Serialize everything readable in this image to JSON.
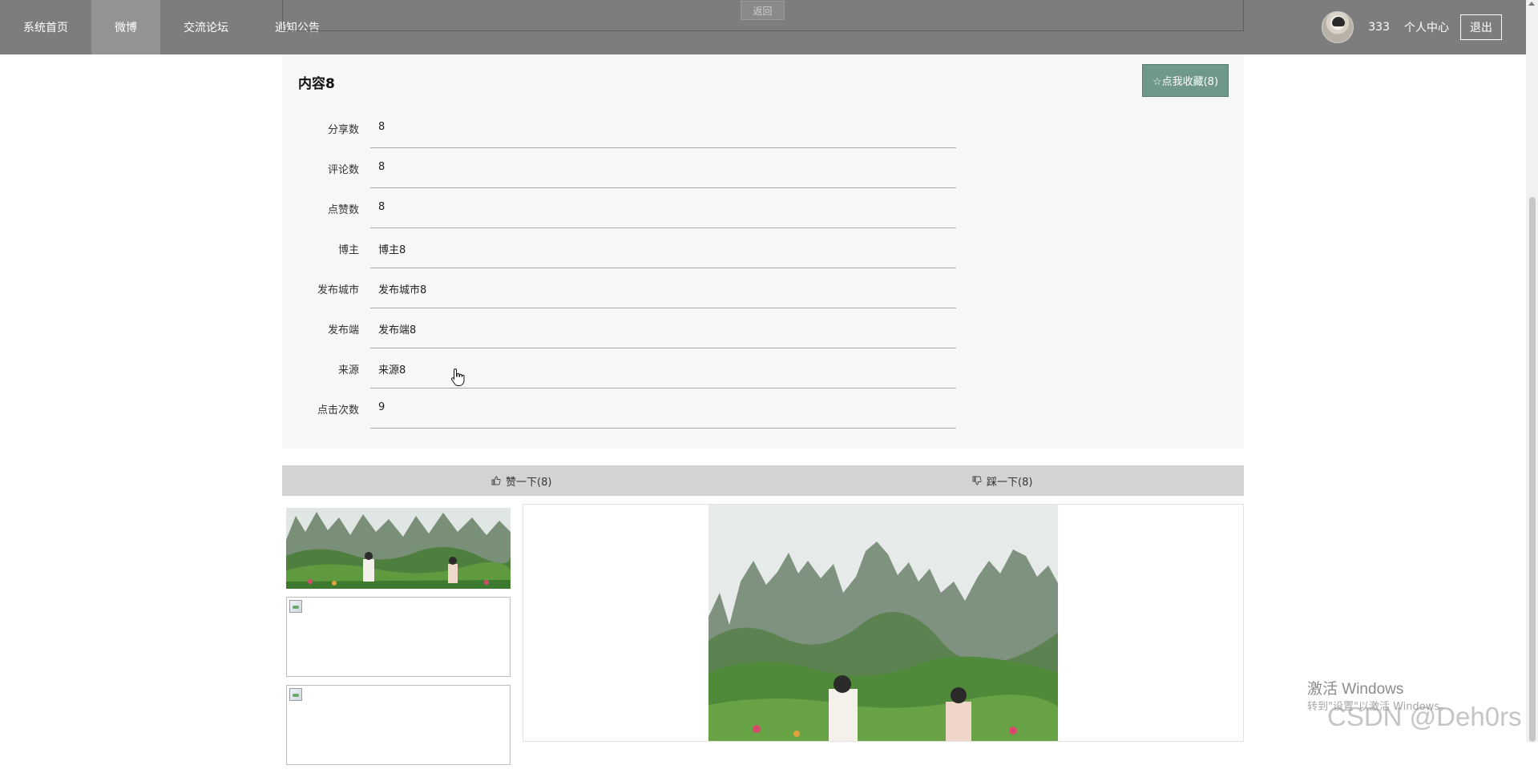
{
  "nav": {
    "items": [
      {
        "label": "系统首页"
      },
      {
        "label": "微博"
      },
      {
        "label": "交流论坛"
      },
      {
        "label": "通知公告"
      }
    ],
    "username": "333",
    "personal_center": "个人中心",
    "logout": "退出"
  },
  "back_label": "返回",
  "detail": {
    "title": "内容8",
    "favorite_label": "☆点我收藏(8)",
    "fields": [
      {
        "label": "分享数",
        "value": "8"
      },
      {
        "label": "评论数",
        "value": "8"
      },
      {
        "label": "点赞数",
        "value": "8"
      },
      {
        "label": "博主",
        "value": "博主8"
      },
      {
        "label": "发布城市",
        "value": "发布城市8"
      },
      {
        "label": "发布端",
        "value": "发布端8"
      },
      {
        "label": "来源",
        "value": "来源8"
      },
      {
        "label": "点击次数",
        "value": "9"
      }
    ]
  },
  "votes": {
    "like_label": "赞一下(8)",
    "dislike_label": "踩一下(8)"
  },
  "watermarks": {
    "windows_title": "激活 Windows",
    "windows_sub": "转到\"设置\"以激活 Windows。",
    "csdn": "CSDN @Deh0rs"
  },
  "colors": {
    "nav_bg": "#7d7d7d",
    "nav_active": "#939393",
    "favorite_button": "#6f988a",
    "panel_bg": "#f7f7f7",
    "vote_bar": "#d3d3d3"
  },
  "icons": {
    "favorite": "star-outline-icon",
    "like": "thumb-up-icon",
    "dislike": "thumb-down-icon"
  }
}
